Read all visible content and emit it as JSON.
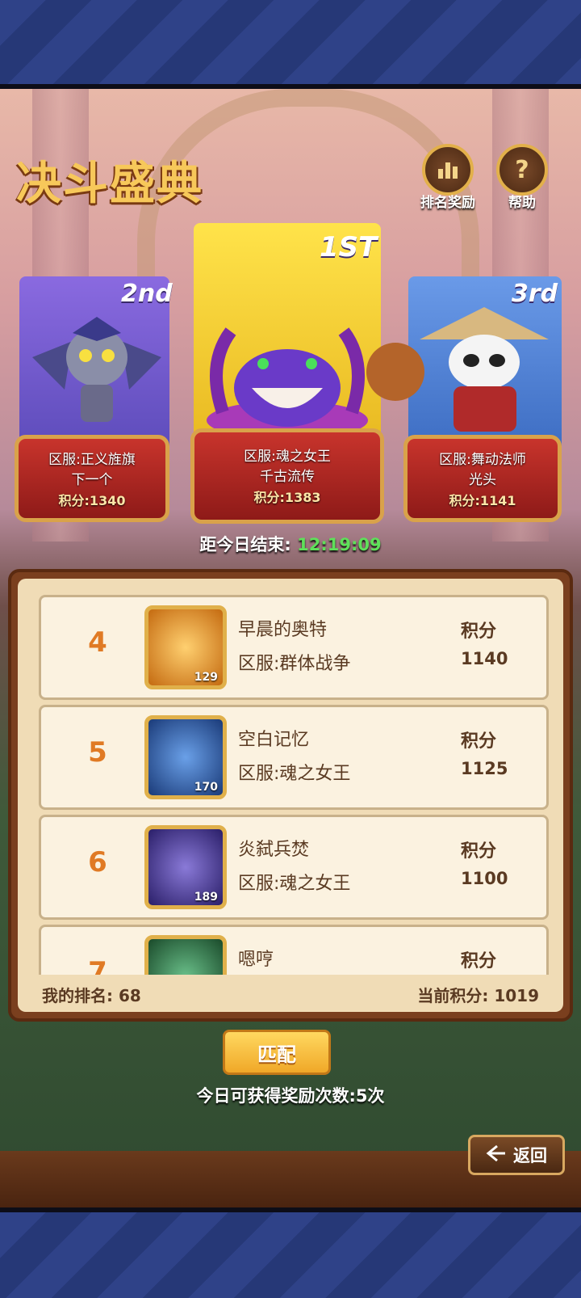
{
  "title": "决斗盛典",
  "top_buttons": {
    "ranking_reward": {
      "label": "排名奖励",
      "icon": "bar-chart-icon"
    },
    "help": {
      "label": "帮助",
      "icon": "question-icon"
    }
  },
  "podium": [
    {
      "rank_tag": "2nd",
      "server": "区服:正义旌旗",
      "player": "下一个",
      "score": "积分:1340",
      "color": "#6a5ad0"
    },
    {
      "rank_tag": "1ST",
      "server": "区服:魂之女王",
      "player": "千古流传",
      "score": "积分:1383",
      "color": "#f2c830"
    },
    {
      "rank_tag": "3rd",
      "server": "区服:舞动法师",
      "player": "光头",
      "score": "积分:1141",
      "color": "#5a88d8"
    }
  ],
  "timer": {
    "label": "距今日结束:",
    "value": "12:19:09"
  },
  "rankings": [
    {
      "rank": "4",
      "name": "早晨的奥特",
      "server": "区服:群体战争",
      "score_label": "积分",
      "score": "1140",
      "level": "129",
      "avatar_color": "#f0a020"
    },
    {
      "rank": "5",
      "name": "空白记忆",
      "server": "区服:魂之女王",
      "score_label": "积分",
      "score": "1125",
      "level": "170",
      "avatar_color": "#3a6ab8"
    },
    {
      "rank": "6",
      "name": "炎弑兵焚",
      "server": "区服:魂之女王",
      "score_label": "积分",
      "score": "1100",
      "level": "189",
      "avatar_color": "#5a4aa8"
    },
    {
      "rank": "7",
      "name": "嗯哼",
      "server": "",
      "score_label": "积分",
      "score": "",
      "level": "",
      "avatar_color": "#3a7a5a"
    }
  ],
  "my_rank": "我的排名: 68",
  "current_score": "当前积分: 1019",
  "match_button": "匹配",
  "reward_info": "今日可获得奖励次数:5次",
  "back_button": "返回"
}
